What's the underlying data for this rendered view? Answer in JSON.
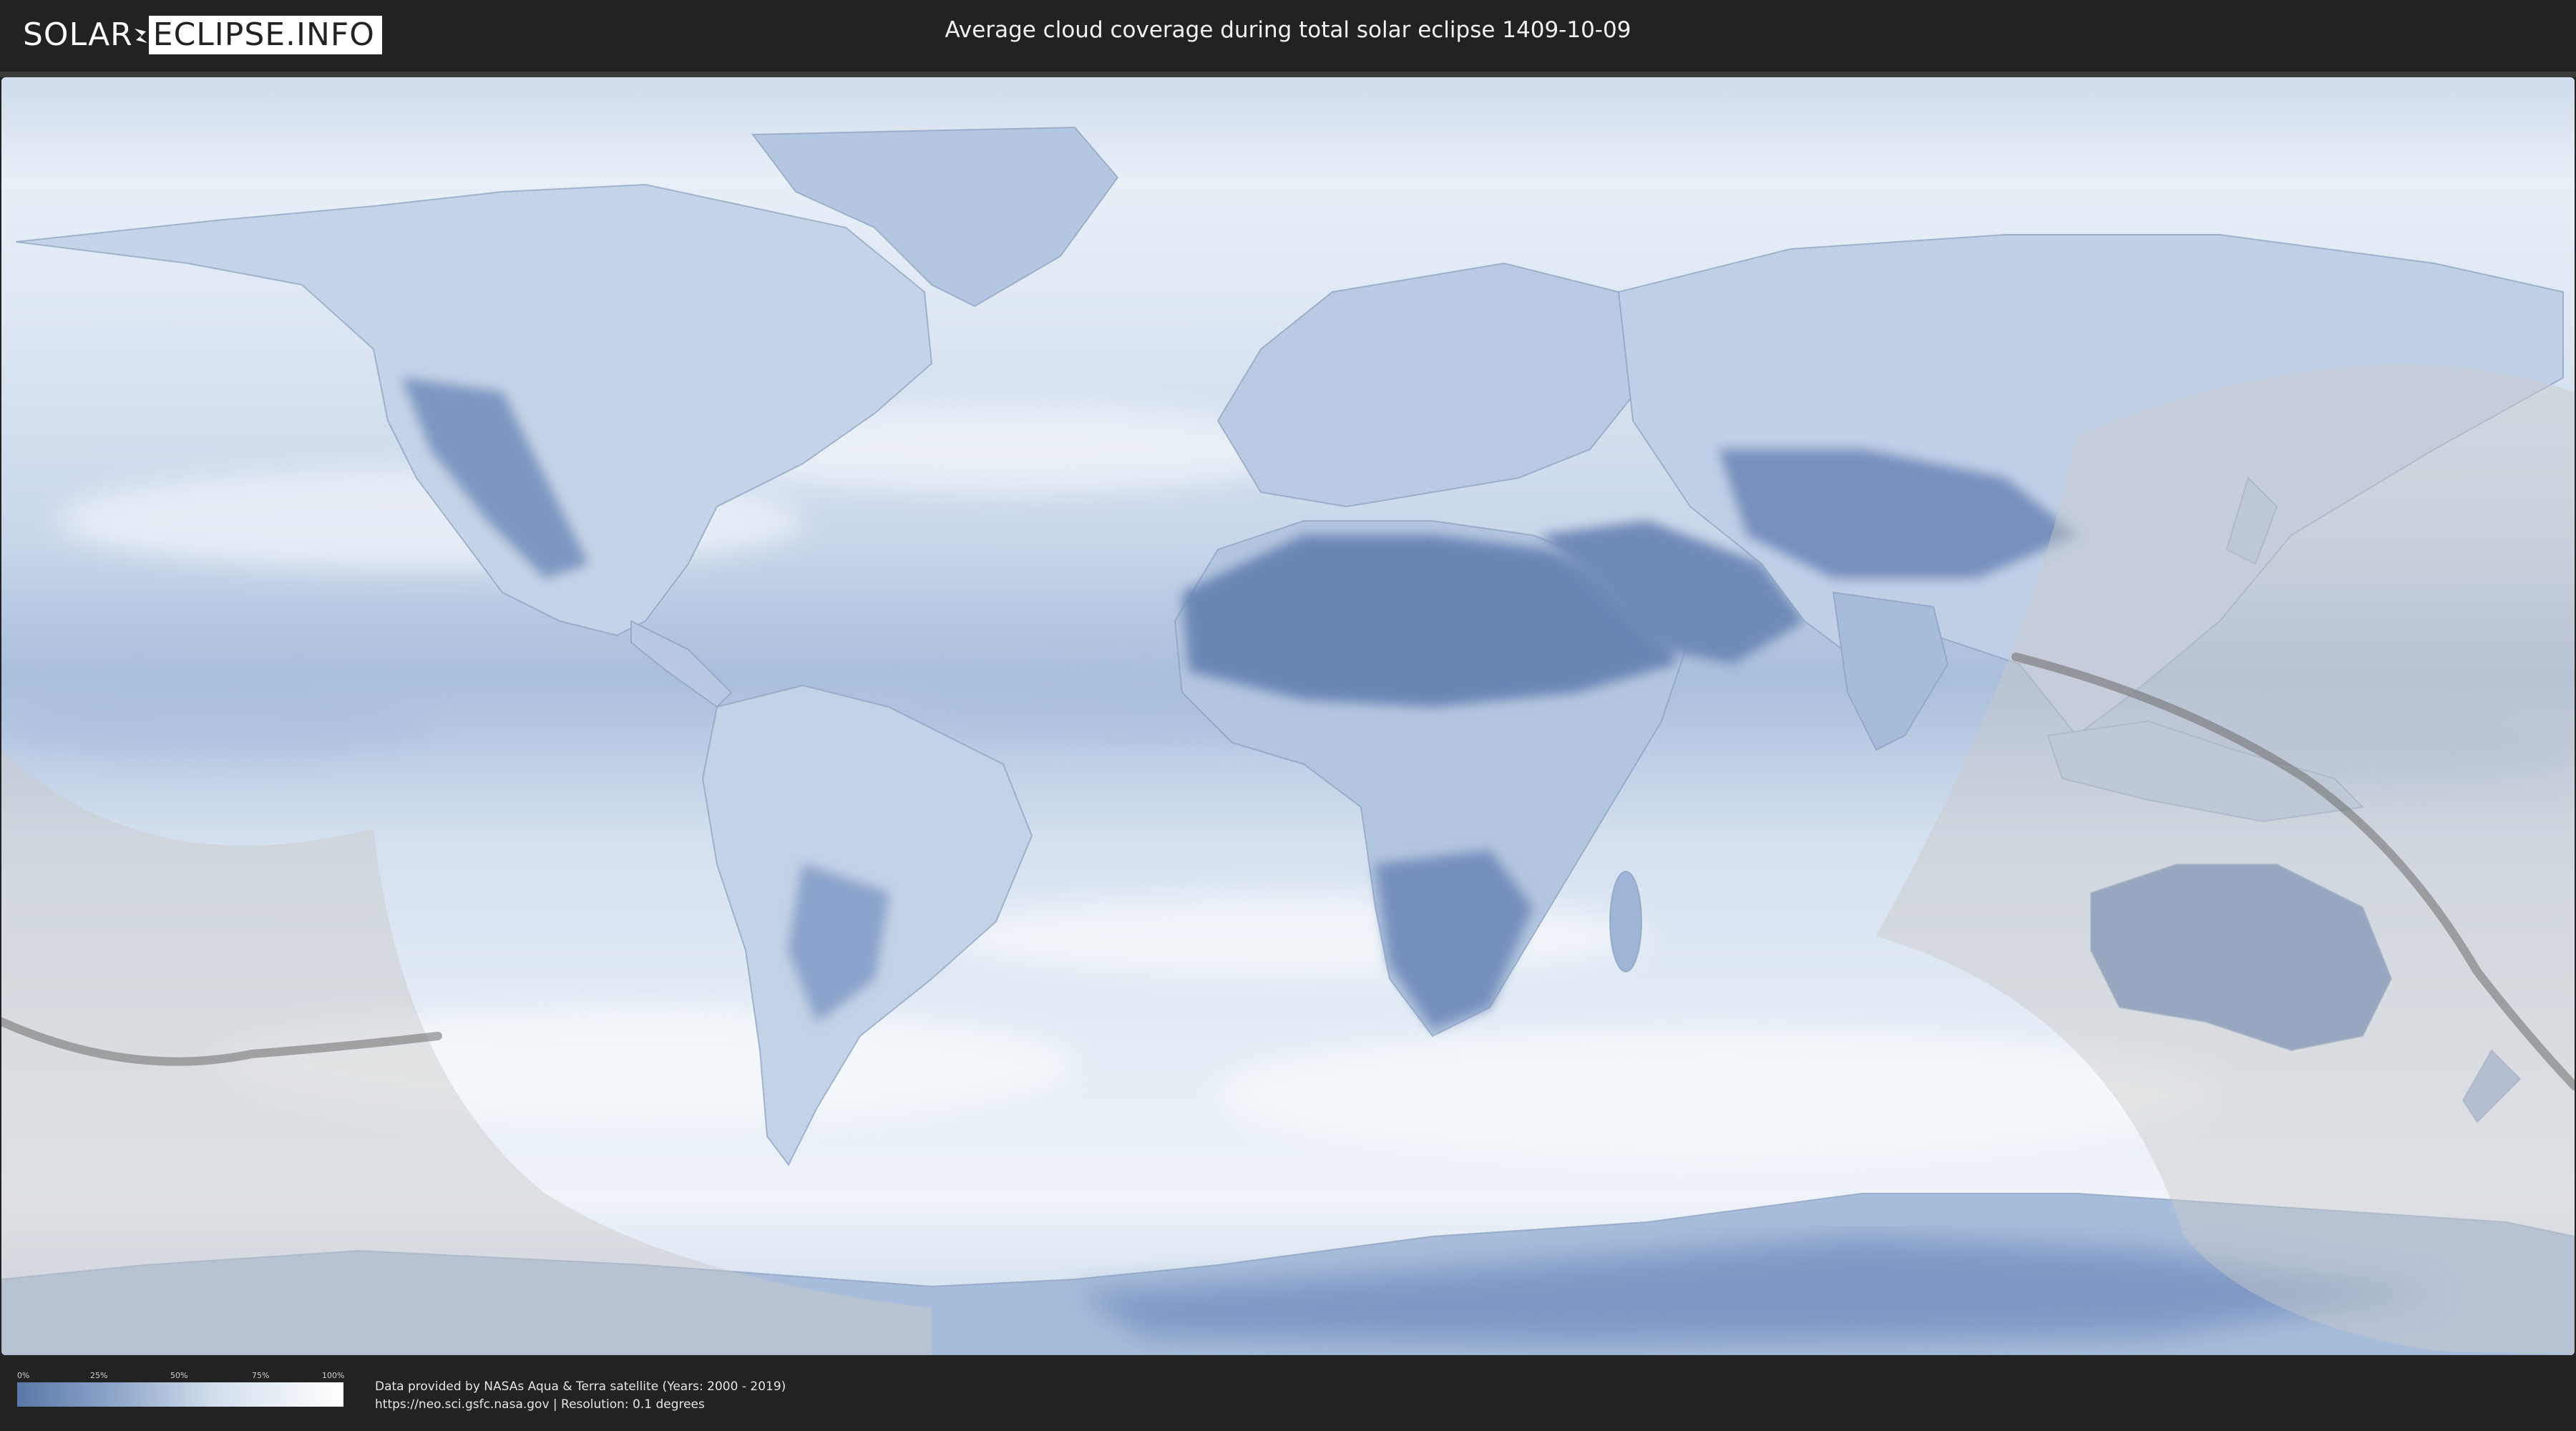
{
  "header": {
    "logo_left": "SOLAR",
    "logo_right": "ECLIPSE.INFO",
    "title": "Average cloud coverage during total solar eclipse 1409-10-09"
  },
  "legend": {
    "ticks": [
      "0%",
      "25%",
      "50%",
      "75%",
      "100%"
    ],
    "color_low": "#5a78a8",
    "color_high": "#ffffff"
  },
  "credits": {
    "line1": "Data provided by NASAs Aqua & Terra satellite (Years: 2000 - 2019)",
    "line2": "https://neo.sci.gsfc.nasa.gov | Resolution: 0.1 degrees"
  },
  "map": {
    "ocean_cloud_color": "#dde7f2",
    "clear_sky_color": "#6f8cb8",
    "eclipse_zone_color": "#c9c9c9",
    "eclipse_path_color": "#6b6b6b"
  }
}
